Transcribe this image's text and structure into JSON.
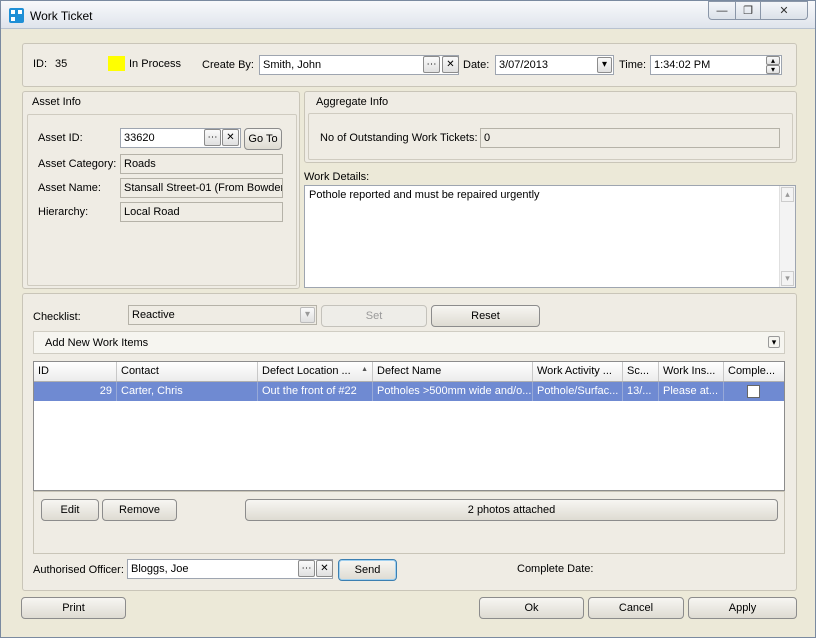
{
  "window": {
    "title": "Work Ticket"
  },
  "header": {
    "id_label": "ID:",
    "id_value": "35",
    "status_color": "#ffff00",
    "status_text": "In Process",
    "created_by_label": "Create By:",
    "created_by_value": "Smith, John",
    "date_label": "Date:",
    "date_value": "3/07/2013",
    "time_label": "Time:",
    "time_value": "1:34:02 PM"
  },
  "asset_info": {
    "title": "Asset Info",
    "asset_id_label": "Asset ID:",
    "asset_id_value": "33620",
    "goto_label": "Go To",
    "category_label": "Asset Category:",
    "category_value": "Roads",
    "name_label": "Asset Name:",
    "name_value": "Stansall Street-01  (From Bowden",
    "hierarchy_label": "Hierarchy:",
    "hierarchy_value": "Local Road"
  },
  "aggregate_info": {
    "title": "Aggregate Info",
    "outstanding_label": "No of Outstanding Work Tickets:",
    "outstanding_value": "0"
  },
  "work_details": {
    "label": "Work Details:",
    "text": "Pothole reported and must be repaired urgently"
  },
  "checklist": {
    "label": "Checklist:",
    "value": "Reactive",
    "set_label": "Set",
    "reset_label": "Reset"
  },
  "work_items": {
    "add_label": "Add New Work Items",
    "columns": [
      "ID",
      "Contact",
      "Defect Location ...",
      "Defect Name",
      "Work Activity ...",
      "Sc...",
      "Work Ins...",
      "Comple..."
    ],
    "rows": [
      {
        "id": "29",
        "contact": "Carter, Chris",
        "location": "Out the front of #22",
        "defect": "Potholes >500mm wide and/o...",
        "activity": "Pothole/Surfac...",
        "sc": "13/...",
        "ins": "Please at...",
        "complete": false
      }
    ],
    "edit_label": "Edit",
    "remove_label": "Remove",
    "photos_label": "2 photos attached"
  },
  "footer": {
    "officer_label": "Authorised Officer:",
    "officer_value": "Bloggs, Joe",
    "send_label": "Send",
    "complete_date_label": "Complete Date:",
    "print_label": "Print",
    "ok_label": "Ok",
    "cancel_label": "Cancel",
    "apply_label": "Apply"
  },
  "icons": {
    "ellipsis": "⋯",
    "clear": "✕",
    "dropdown": "▾",
    "spin_up": "▴",
    "spin_down": "▾",
    "sort_up": "▲",
    "min": "—",
    "restore": "❐",
    "close": "✕",
    "scroll_up": "▴",
    "scroll_down": "▾",
    "expand": "▾"
  },
  "colors": {
    "selection": "#6f8ad2"
  }
}
